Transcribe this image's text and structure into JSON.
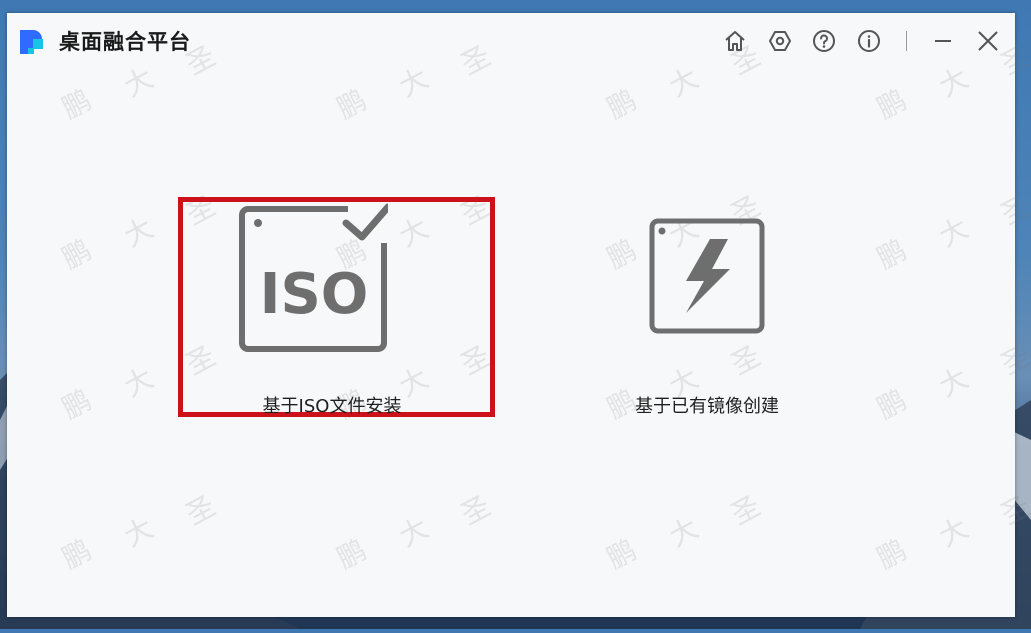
{
  "app": {
    "title": "桌面融合平台"
  },
  "titlebar": {
    "buttons": [
      {
        "icon": "home-icon"
      },
      {
        "icon": "settings-icon"
      },
      {
        "icon": "help-icon"
      },
      {
        "icon": "info-icon"
      },
      {
        "icon": "minimize-icon"
      },
      {
        "icon": "close-icon"
      }
    ]
  },
  "options": {
    "iso": {
      "icon_text": "ISO",
      "label": "基于ISO文件安装",
      "selected": true
    },
    "image": {
      "label": "基于已有镜像创建"
    }
  },
  "watermark": {
    "chars": [
      "鹏",
      "大",
      "圣"
    ]
  },
  "colors": {
    "window_bg": "#f7f8fa",
    "icon_gray": "#6e6e6e",
    "highlight_red": "#cc111b",
    "logo_blue": "#2f6bff",
    "logo_cyan": "#18c4e6"
  }
}
